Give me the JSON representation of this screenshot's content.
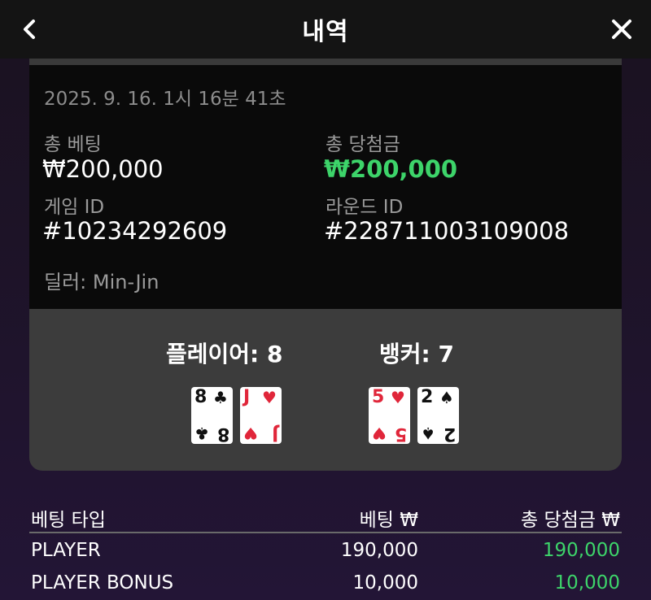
{
  "header": {
    "title": "내역",
    "back_icon": "chevron-left-icon",
    "close_icon": "close-icon"
  },
  "info": {
    "date": "2025. 9. 16. 1시 16분 41초",
    "total_bet_label": "총 베팅",
    "total_bet_value": "₩200,000",
    "total_win_label": "총 당첨금",
    "total_win_value": "₩200,000",
    "game_id_label": "게임 ID",
    "game_id_value": "#10234292609",
    "round_id_label": "라운드 ID",
    "round_id_value": "#228711003109008",
    "dealer": "딜러: Min-Jin"
  },
  "result": {
    "player_score": "플레이어: 8",
    "banker_score": "뱅커: 7",
    "player_cards": [
      {
        "rank": "8",
        "suit": "♣",
        "color": "black"
      },
      {
        "rank": "J",
        "suit": "♥",
        "color": "red"
      }
    ],
    "banker_cards": [
      {
        "rank": "5",
        "suit": "♥",
        "color": "red"
      },
      {
        "rank": "2",
        "suit": "♠",
        "color": "black"
      }
    ]
  },
  "bets": {
    "headers": [
      "베팅 타입",
      "베팅 ₩",
      "총 당첨금 ₩"
    ],
    "rows": [
      {
        "type": "PLAYER",
        "bet": "190,000",
        "win": "190,000"
      },
      {
        "type": "PLAYER BONUS",
        "bet": "10,000",
        "win": "10,000"
      }
    ]
  },
  "colors": {
    "win_green": "#3dd46a",
    "card_red": "#e0263a"
  }
}
